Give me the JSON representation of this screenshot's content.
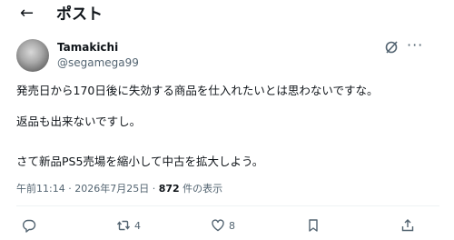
{
  "header": {
    "back_icon": "arrow-left-icon",
    "title": "ポスト"
  },
  "post": {
    "author": {
      "display_name": "Tamakichi",
      "handle": "@segamega99"
    },
    "lines": [
      "発売日から170日後に失効する商品を仕入れたいとは思わないですな。",
      "返品も出来ないですし。",
      "さて新品PS5売場を縮小して中古を拡大しよう。"
    ],
    "meta": {
      "time": "午前11:14",
      "separator": " · ",
      "date": "2026年7月25日",
      "views_count": "872",
      "views_label": " 件の表示"
    },
    "actions": {
      "reply_count": "",
      "repost_count": "4",
      "like_count": "8"
    }
  }
}
